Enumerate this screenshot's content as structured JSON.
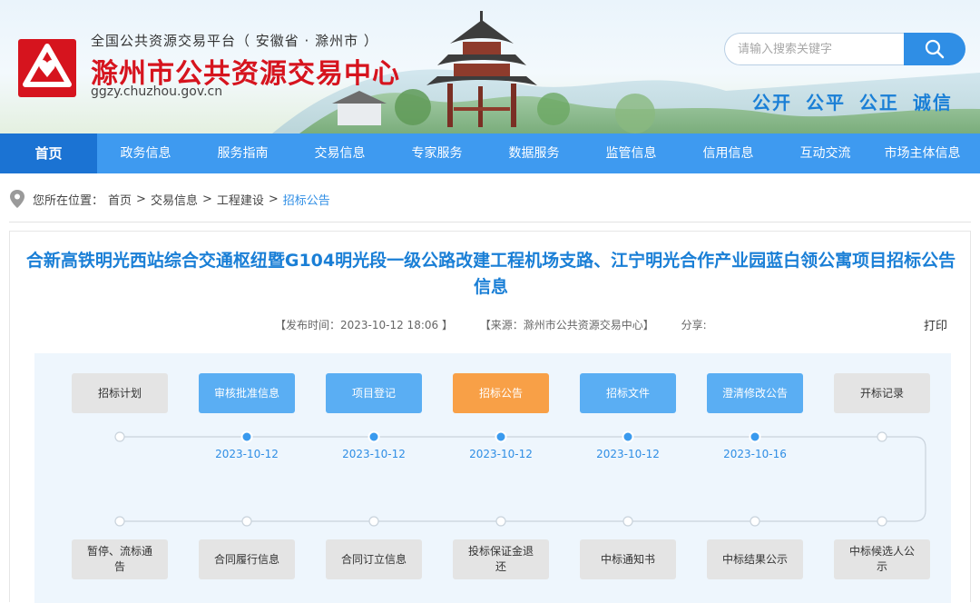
{
  "header": {
    "platform_name": "全国公共资源交易平台（ 安徽省 · 滁州市 ）",
    "site_title": "滁州市公共资源交易中心",
    "site_url": "ggzy.chuzhou.gov.cn",
    "search": {
      "placeholder": "请输入搜索关键字"
    },
    "motto": "公开 公平 公正 诚信"
  },
  "nav": {
    "items": [
      "首页",
      "政务信息",
      "服务指南",
      "交易信息",
      "专家服务",
      "数据服务",
      "监管信息",
      "信用信息",
      "互动交流",
      "市场主体信息"
    ],
    "active_index": 0
  },
  "breadcrumb": {
    "prefix": "您所在位置：",
    "items": [
      "首页",
      "交易信息",
      "工程建设",
      "招标公告"
    ],
    "separator": ">"
  },
  "article": {
    "title": "合新高铁明光西站综合交通枢纽暨G104明光段一级公路改建工程机场支路、江宁明光合作产业园蓝白领公寓项目招标公告信息",
    "publish_time": "【发布时间：2023-10-12 18:06 】",
    "source": "【来源：滁州市公共资源交易中心】",
    "share": "分享:",
    "print": "打印"
  },
  "flow": {
    "top_steps": [
      {
        "label": "招标计划",
        "state": "grey"
      },
      {
        "label": "审核批准信息",
        "state": "blue"
      },
      {
        "label": "项目登记",
        "state": "blue"
      },
      {
        "label": "招标公告",
        "state": "orange"
      },
      {
        "label": "招标文件",
        "state": "blue"
      },
      {
        "label": "澄清修改公告",
        "state": "blue"
      },
      {
        "label": "开标记录",
        "state": "grey"
      }
    ],
    "top_dates": [
      "",
      "2023-10-12",
      "2023-10-12",
      "2023-10-12",
      "2023-10-12",
      "2023-10-16",
      ""
    ],
    "bottom_steps": [
      {
        "label": "暂停、流标通告",
        "state": "grey"
      },
      {
        "label": "合同履行信息",
        "state": "grey"
      },
      {
        "label": "合同订立信息",
        "state": "grey"
      },
      {
        "label": "投标保证金退还",
        "state": "grey"
      },
      {
        "label": "中标通知书",
        "state": "grey"
      },
      {
        "label": "中标结果公示",
        "state": "grey"
      },
      {
        "label": "中标候选人公示",
        "state": "grey"
      }
    ],
    "colors": {
      "active": "#5aaef3",
      "current": "#f8a047",
      "inactive": "#e4e4e4",
      "line": "#c9d3dc"
    }
  }
}
